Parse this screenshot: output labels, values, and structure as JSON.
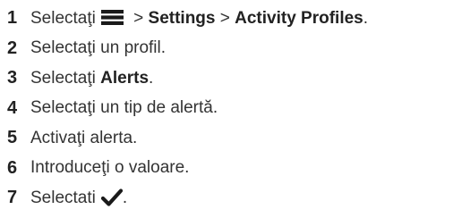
{
  "steps": [
    {
      "number": "1",
      "prefix": "Selectaţi",
      "icon": "menu-icon",
      "separator_1": " > ",
      "part_1": "Settings",
      "separator_2": " > ",
      "part_2": "Activity Profiles",
      "suffix": "."
    },
    {
      "number": "2",
      "text": "Selectaţi un profil."
    },
    {
      "number": "3",
      "prefix": "Selectaţi",
      "bold": "Alerts",
      "suffix": "."
    },
    {
      "number": "4",
      "text": "Selectaţi un tip de alertă."
    },
    {
      "number": "5",
      "text": "Activaţi alerta."
    },
    {
      "number": "6",
      "text": "Introduceţi o valoare."
    },
    {
      "number": "7",
      "prefix": "Selectati",
      "icon": "checkmark-icon",
      "suffix": "."
    }
  ],
  "colors": {
    "text": "#333333",
    "number": "#222222",
    "icon": "#1a1a1a"
  }
}
